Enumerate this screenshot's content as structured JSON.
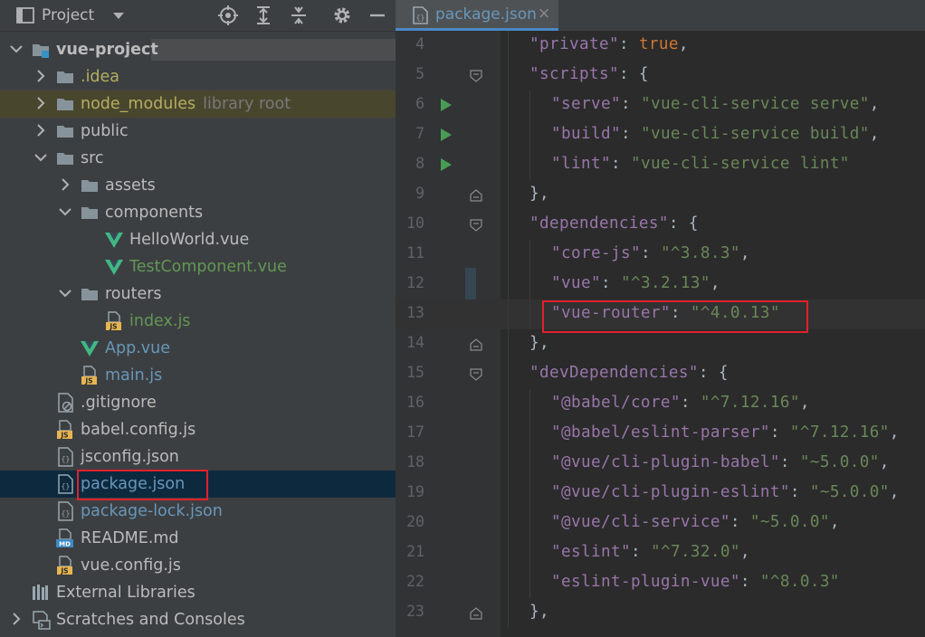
{
  "project_panel": {
    "title": "Project",
    "tree": [
      {
        "label": "vue-project",
        "hint": "",
        "indent": 0,
        "chevron": "down",
        "icon": "module-folder",
        "color": "white",
        "bold": true
      },
      {
        "label": ".idea",
        "hint": "",
        "indent": 1,
        "chevron": "right",
        "icon": "folder",
        "color": "yellow"
      },
      {
        "label": "node_modules",
        "hint": "library root",
        "indent": 1,
        "chevron": "right",
        "icon": "folder",
        "color": "yellow",
        "highlight": true
      },
      {
        "label": "public",
        "hint": "",
        "indent": 1,
        "chevron": "right",
        "icon": "folder",
        "color": "white"
      },
      {
        "label": "src",
        "hint": "",
        "indent": 1,
        "chevron": "down",
        "icon": "folder",
        "color": "white"
      },
      {
        "label": "assets",
        "hint": "",
        "indent": 2,
        "chevron": "right",
        "icon": "folder",
        "color": "white"
      },
      {
        "label": "components",
        "hint": "",
        "indent": 2,
        "chevron": "down",
        "icon": "folder",
        "color": "white"
      },
      {
        "label": "HelloWorld.vue",
        "hint": "",
        "indent": 3,
        "chevron": "",
        "icon": "vue",
        "color": "white"
      },
      {
        "label": "TestComponent.vue",
        "hint": "",
        "indent": 3,
        "chevron": "",
        "icon": "vue",
        "color": "green"
      },
      {
        "label": "routers",
        "hint": "",
        "indent": 2,
        "chevron": "down",
        "icon": "folder",
        "color": "white"
      },
      {
        "label": "index.js",
        "hint": "",
        "indent": 3,
        "chevron": "",
        "icon": "js",
        "color": "green"
      },
      {
        "label": "App.vue",
        "hint": "",
        "indent": 2,
        "chevron": "",
        "icon": "vue",
        "color": "blue"
      },
      {
        "label": "main.js",
        "hint": "",
        "indent": 2,
        "chevron": "",
        "icon": "js",
        "color": "blue"
      },
      {
        "label": ".gitignore",
        "hint": "",
        "indent": 1,
        "chevron": "",
        "icon": "ignore",
        "color": "white"
      },
      {
        "label": "babel.config.js",
        "hint": "",
        "indent": 1,
        "chevron": "",
        "icon": "js",
        "color": "white"
      },
      {
        "label": "jsconfig.json",
        "hint": "",
        "indent": 1,
        "chevron": "",
        "icon": "json",
        "color": "white"
      },
      {
        "label": "package.json",
        "hint": "",
        "indent": 1,
        "chevron": "",
        "icon": "json",
        "color": "blue",
        "selected": true,
        "boxed": true
      },
      {
        "label": "package-lock.json",
        "hint": "",
        "indent": 1,
        "chevron": "",
        "icon": "json",
        "color": "blue"
      },
      {
        "label": "README.md",
        "hint": "",
        "indent": 1,
        "chevron": "",
        "icon": "md",
        "color": "white"
      },
      {
        "label": "vue.config.js",
        "hint": "",
        "indent": 1,
        "chevron": "",
        "icon": "js",
        "color": "white"
      },
      {
        "label": "External Libraries",
        "hint": "",
        "indent": 0,
        "chevron": "",
        "icon": "libraries",
        "color": "white"
      },
      {
        "label": "Scratches and Consoles",
        "hint": "",
        "indent": 0,
        "chevron": "right",
        "icon": "scratches",
        "color": "white"
      }
    ]
  },
  "editor": {
    "tab_label": "package.json",
    "tab_close": "×",
    "lines": [
      {
        "n": "4",
        "depth": 1,
        "tokens": [
          [
            "k",
            "\"private\""
          ],
          [
            "p",
            ": "
          ],
          [
            "kw",
            "true"
          ],
          [
            "p",
            ","
          ]
        ]
      },
      {
        "n": "5",
        "depth": 1,
        "fold": "open",
        "tokens": [
          [
            "k",
            "\"scripts\""
          ],
          [
            "p",
            ": {"
          ]
        ]
      },
      {
        "n": "6",
        "depth": 2,
        "run": true,
        "tokens": [
          [
            "k",
            "\"serve\""
          ],
          [
            "p",
            ": "
          ],
          [
            "s",
            "\"vue-cli-service serve\""
          ],
          [
            "p",
            ","
          ]
        ]
      },
      {
        "n": "7",
        "depth": 2,
        "run": true,
        "tokens": [
          [
            "k",
            "\"build\""
          ],
          [
            "p",
            ": "
          ],
          [
            "s",
            "\"vue-cli-service build\""
          ],
          [
            "p",
            ","
          ]
        ]
      },
      {
        "n": "8",
        "depth": 2,
        "run": true,
        "tokens": [
          [
            "k",
            "\"lint\""
          ],
          [
            "p",
            ": "
          ],
          [
            "s",
            "\"vue-cli-service lint\""
          ]
        ]
      },
      {
        "n": "9",
        "depth": 1,
        "fold": "close",
        "tokens": [
          [
            "p",
            "},"
          ]
        ]
      },
      {
        "n": "10",
        "depth": 1,
        "fold": "open",
        "tokens": [
          [
            "k",
            "\"dependencies\""
          ],
          [
            "p",
            ": {"
          ]
        ]
      },
      {
        "n": "11",
        "depth": 2,
        "tokens": [
          [
            "k",
            "\"core-js\""
          ],
          [
            "p",
            ": "
          ],
          [
            "s",
            "\"^3.8.3\""
          ],
          [
            "p",
            ","
          ]
        ]
      },
      {
        "n": "12",
        "depth": 2,
        "tokens": [
          [
            "k",
            "\"vue\""
          ],
          [
            "p",
            ": "
          ],
          [
            "s",
            "\"^3.2.13\""
          ],
          [
            "p",
            ","
          ]
        ]
      },
      {
        "n": "13",
        "depth": 2,
        "current": true,
        "boxed": true,
        "tokens": [
          [
            "k",
            "\"vue-router\""
          ],
          [
            "p",
            ": "
          ],
          [
            "s",
            "\"^4.0.13\""
          ]
        ]
      },
      {
        "n": "14",
        "depth": 1,
        "fold": "close",
        "tokens": [
          [
            "p",
            "},"
          ]
        ]
      },
      {
        "n": "15",
        "depth": 1,
        "fold": "open",
        "tokens": [
          [
            "k",
            "\"devDependencies\""
          ],
          [
            "p",
            ": {"
          ]
        ]
      },
      {
        "n": "16",
        "depth": 2,
        "tokens": [
          [
            "k",
            "\"@babel/core\""
          ],
          [
            "p",
            ": "
          ],
          [
            "s",
            "\"^7.12.16\""
          ],
          [
            "p",
            ","
          ]
        ]
      },
      {
        "n": "17",
        "depth": 2,
        "tokens": [
          [
            "k",
            "\"@babel/eslint-parser\""
          ],
          [
            "p",
            ": "
          ],
          [
            "s",
            "\"^7.12.16\""
          ],
          [
            "p",
            ","
          ]
        ]
      },
      {
        "n": "18",
        "depth": 2,
        "tokens": [
          [
            "k",
            "\"@vue/cli-plugin-babel\""
          ],
          [
            "p",
            ": "
          ],
          [
            "s",
            "\"~5.0.0\""
          ],
          [
            "p",
            ","
          ]
        ]
      },
      {
        "n": "19",
        "depth": 2,
        "tokens": [
          [
            "k",
            "\"@vue/cli-plugin-eslint\""
          ],
          [
            "p",
            ": "
          ],
          [
            "s",
            "\"~5.0.0\""
          ],
          [
            "p",
            ","
          ]
        ]
      },
      {
        "n": "20",
        "depth": 2,
        "tokens": [
          [
            "k",
            "\"@vue/cli-service\""
          ],
          [
            "p",
            ": "
          ],
          [
            "s",
            "\"~5.0.0\""
          ],
          [
            "p",
            ","
          ]
        ]
      },
      {
        "n": "21",
        "depth": 2,
        "tokens": [
          [
            "k",
            "\"eslint\""
          ],
          [
            "p",
            ": "
          ],
          [
            "s",
            "\"^7.32.0\""
          ],
          [
            "p",
            ","
          ]
        ]
      },
      {
        "n": "22",
        "depth": 2,
        "tokens": [
          [
            "k",
            "\"eslint-plugin-vue\""
          ],
          [
            "p",
            ": "
          ],
          [
            "s",
            "\"^8.0.3\""
          ]
        ]
      },
      {
        "n": "23",
        "depth": 1,
        "fold": "close",
        "tokens": [
          [
            "p",
            "},"
          ]
        ]
      }
    ]
  },
  "colors": {
    "panel_bg": "#3c3f41",
    "editor_bg": "#2b2b2b",
    "selection": "#0d293e",
    "key_purple": "#9876aa",
    "string_green": "#6a8759",
    "keyword_orange": "#cc7832",
    "highlight_red": "#e0212b"
  }
}
